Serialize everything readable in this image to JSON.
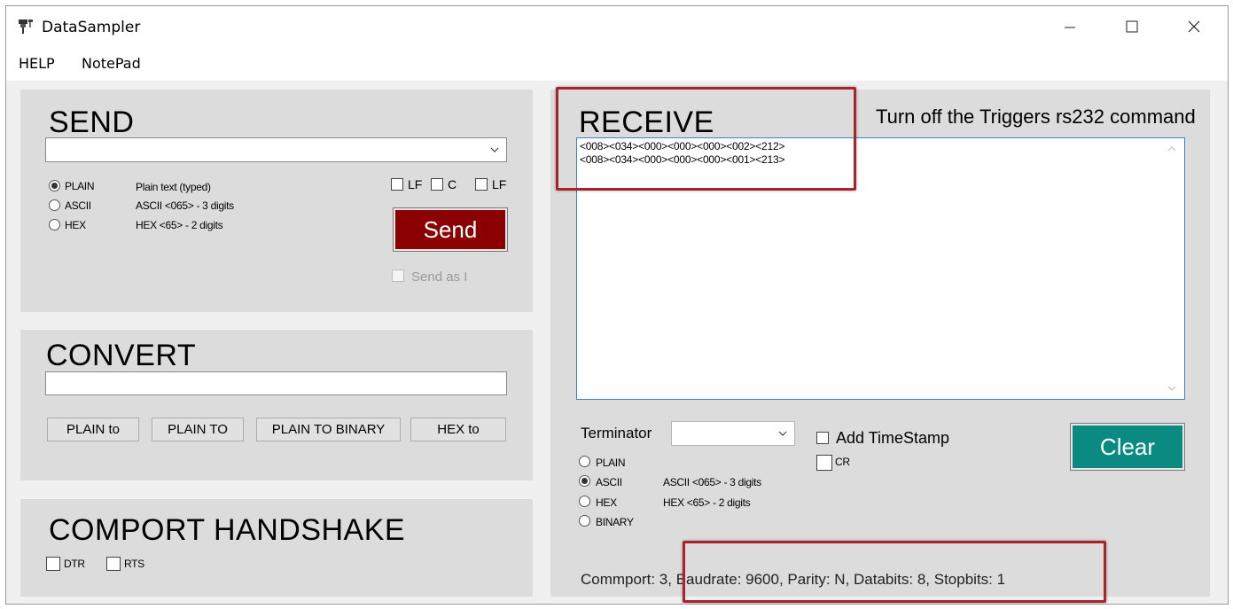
{
  "window": {
    "title": "DataSampler",
    "icon": "datasampler-app-icon",
    "controls": [
      "minimize-icon",
      "maximize-icon",
      "close-icon"
    ]
  },
  "menu": {
    "help": "HELP",
    "notepad": "NotePad"
  },
  "send": {
    "title": "SEND",
    "input_value": "",
    "modes": [
      {
        "label": "PLAIN",
        "desc": "Plain text (typed)",
        "checked": true
      },
      {
        "label": "ASCII",
        "desc": "ASCII <065> - 3 digits",
        "checked": false
      },
      {
        "label": "HEX",
        "desc": "HEX <65> - 2 digits",
        "checked": false
      }
    ],
    "check_lf1": "LF",
    "check_c": "C",
    "check_lf2": "LF",
    "send_label": "Send",
    "send_as_label": "Send as I",
    "send_color": "#8b0000"
  },
  "convert": {
    "title": "CONVERT",
    "input_value": "",
    "buttons": [
      "PLAIN to",
      "PLAIN TO",
      "PLAIN TO BINARY",
      "HEX to"
    ]
  },
  "handshake": {
    "title": "COMPORT HANDSHAKE",
    "dtr": "DTR",
    "rts": "RTS"
  },
  "receive": {
    "title": "RECEIVE",
    "info": "Turn off the Triggers rs232 command",
    "lines": [
      "<008><034><000><000><000><002><212>",
      "<008><034><000><000><000><001><213>"
    ],
    "terminator_label": "Terminator",
    "terminator_value": "",
    "timestamp_label": "Add TimeStamp",
    "cr_label": "CR",
    "modes": [
      {
        "label": "PLAIN",
        "desc": "",
        "checked": false
      },
      {
        "label": "ASCII",
        "desc": "ASCII <065> - 3 digits",
        "checked": true
      },
      {
        "label": "HEX",
        "desc": "HEX <65> - 2 digits",
        "checked": false
      },
      {
        "label": "BINARY",
        "desc": "",
        "checked": false
      }
    ],
    "clear_label": "Clear",
    "clear_color": "#0b8a82",
    "status": "Commport: 3, Baudrate: 9600, Parity: N, Databits: 8, Stopbits: 1"
  },
  "highlight_color": "#a8242a"
}
